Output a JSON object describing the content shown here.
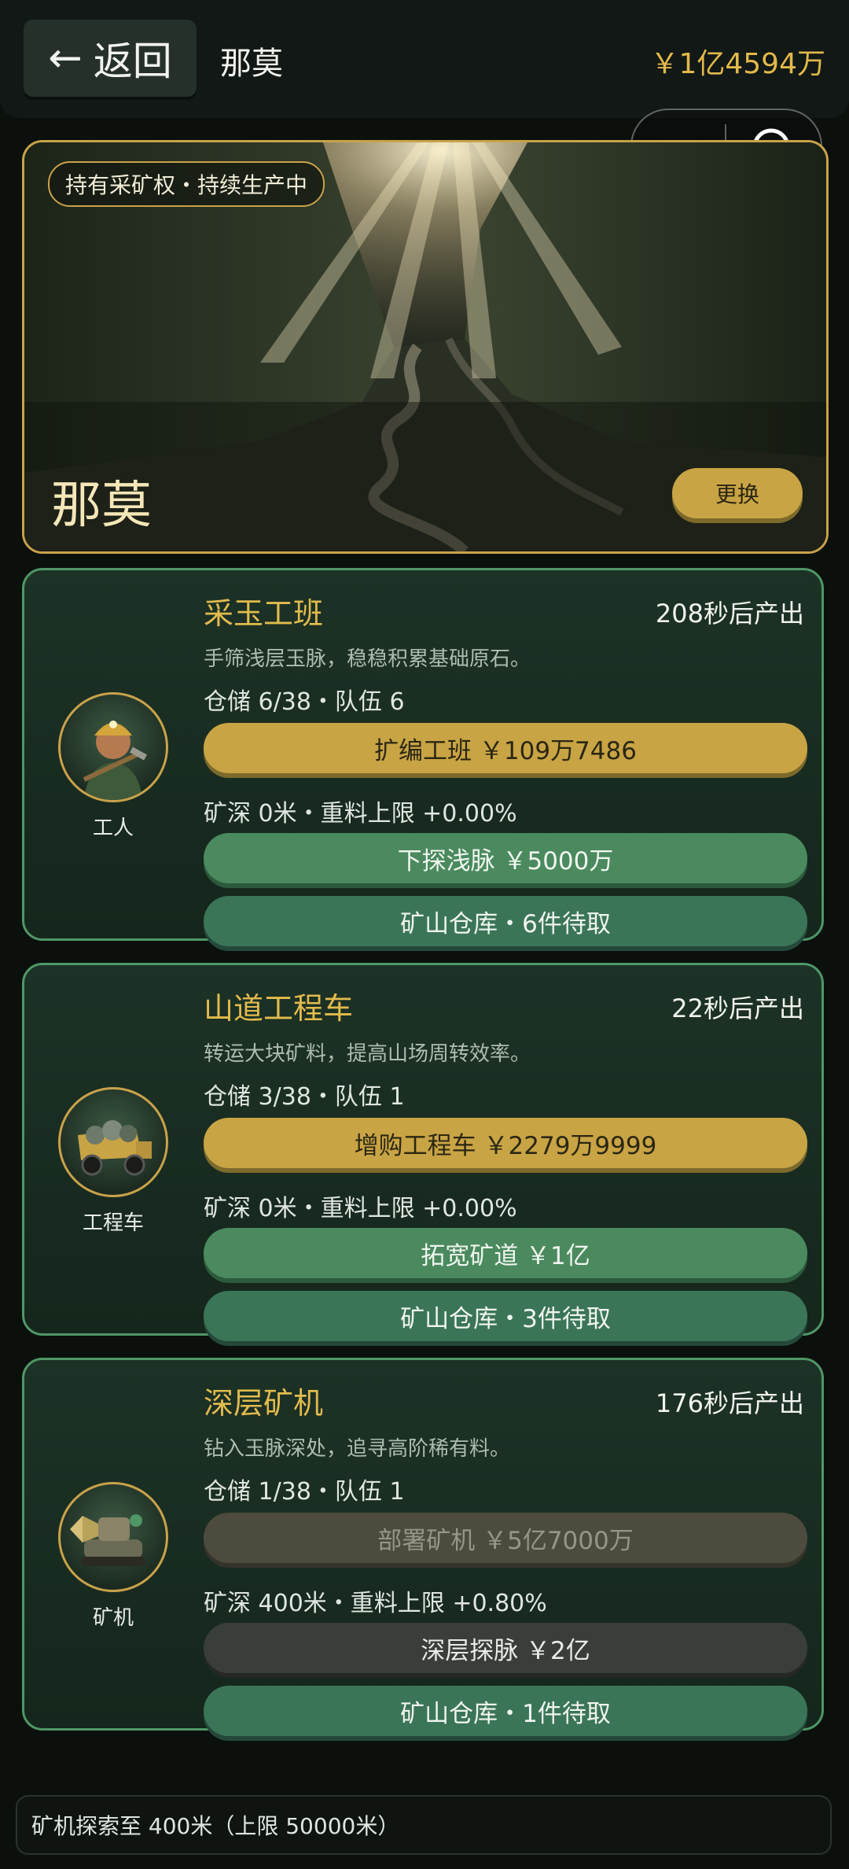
{
  "header": {
    "back_label": "返回",
    "title": "那莫",
    "balance": "￥1亿4594万"
  },
  "banner": {
    "license_badge": "持有采矿权・持续生产中",
    "mine_name": "那莫",
    "change_label": "更换"
  },
  "cards": [
    {
      "title": "采玉工班",
      "timer": "208秒后产出",
      "description": "手筛浅层玉脉，稳稳积累基础原石。",
      "storage": "仓储 6/38・队伍 6",
      "primary_action": "扩编工班 ￥109万7486",
      "depth": "矿深 0米・重料上限 +0.00%",
      "secondary_action": "下探浅脉 ￥5000万",
      "warehouse": "矿山仓库・6件待取",
      "avatar_label": "工人",
      "avatar_icon": "worker-avatar-icon"
    },
    {
      "title": "山道工程车",
      "timer": "22秒后产出",
      "description": "转运大块矿料，提高山场周转效率。",
      "storage": "仓储 3/38・队伍 1",
      "primary_action": "增购工程车 ￥2279万9999",
      "depth": "矿深 0米・重料上限 +0.00%",
      "secondary_action": "拓宽矿道 ￥1亿",
      "warehouse": "矿山仓库・3件待取",
      "avatar_label": "工程车",
      "avatar_icon": "dump-truck-avatar-icon"
    },
    {
      "title": "深层矿机",
      "timer": "176秒后产出",
      "description": "钻入玉脉深处，追寻高阶稀有料。",
      "storage": "仓储 1/38・队伍 1",
      "primary_action": "部署矿机 ￥5亿7000万",
      "depth": "矿深 400米・重料上限 +0.80%",
      "secondary_action": "深层探脉 ￥2亿",
      "warehouse": "矿山仓库・1件待取",
      "avatar_label": "矿机",
      "avatar_icon": "drill-machine-avatar-icon"
    }
  ],
  "footer": {
    "status": "矿机探索至 400米（上限 50000米）"
  }
}
